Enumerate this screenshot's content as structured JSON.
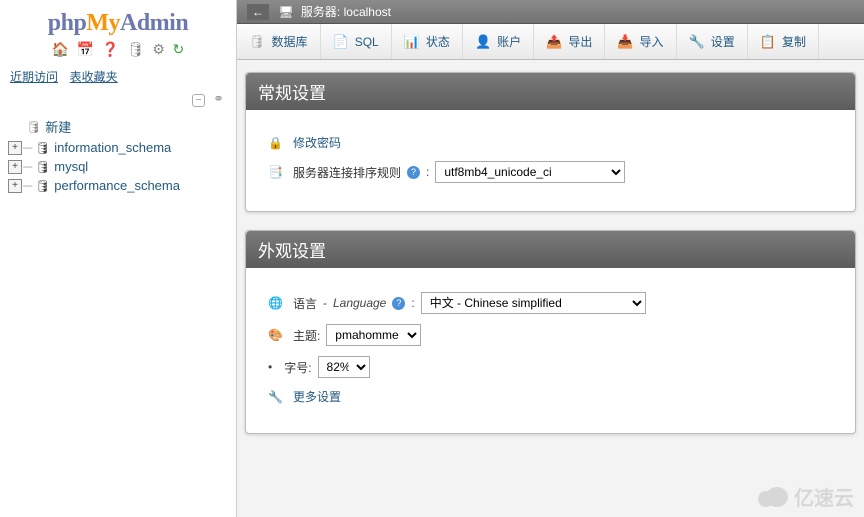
{
  "logo": {
    "part1": "php",
    "part2": "My",
    "part3": "Admin"
  },
  "sidebar_tabs": {
    "recent": "近期访问",
    "favorites": "表收藏夹"
  },
  "tree": {
    "new": "新建",
    "dbs": [
      "information_schema",
      "mysql",
      "performance_schema"
    ]
  },
  "breadcrumb": {
    "server_label": "服务器:",
    "server_value": "localhost"
  },
  "tabs": {
    "databases": "数据库",
    "sql": "SQL",
    "status": "状态",
    "accounts": "账户",
    "export": "导出",
    "import": "导入",
    "settings": "设置",
    "replication": "复制"
  },
  "panel_general": {
    "title": "常规设置",
    "change_password": "修改密码",
    "collation_label": "服务器连接排序规则",
    "collation_value": "utf8mb4_unicode_ci"
  },
  "panel_appearance": {
    "title": "外观设置",
    "language_label_cn": "语言",
    "language_label_en": "Language",
    "language_value": "中文 - Chinese simplified",
    "theme_label": "主题:",
    "theme_value": "pmahomme",
    "fontsize_label": "字号:",
    "fontsize_value": "82%",
    "more_settings": "更多设置"
  },
  "watermark": "亿速云"
}
